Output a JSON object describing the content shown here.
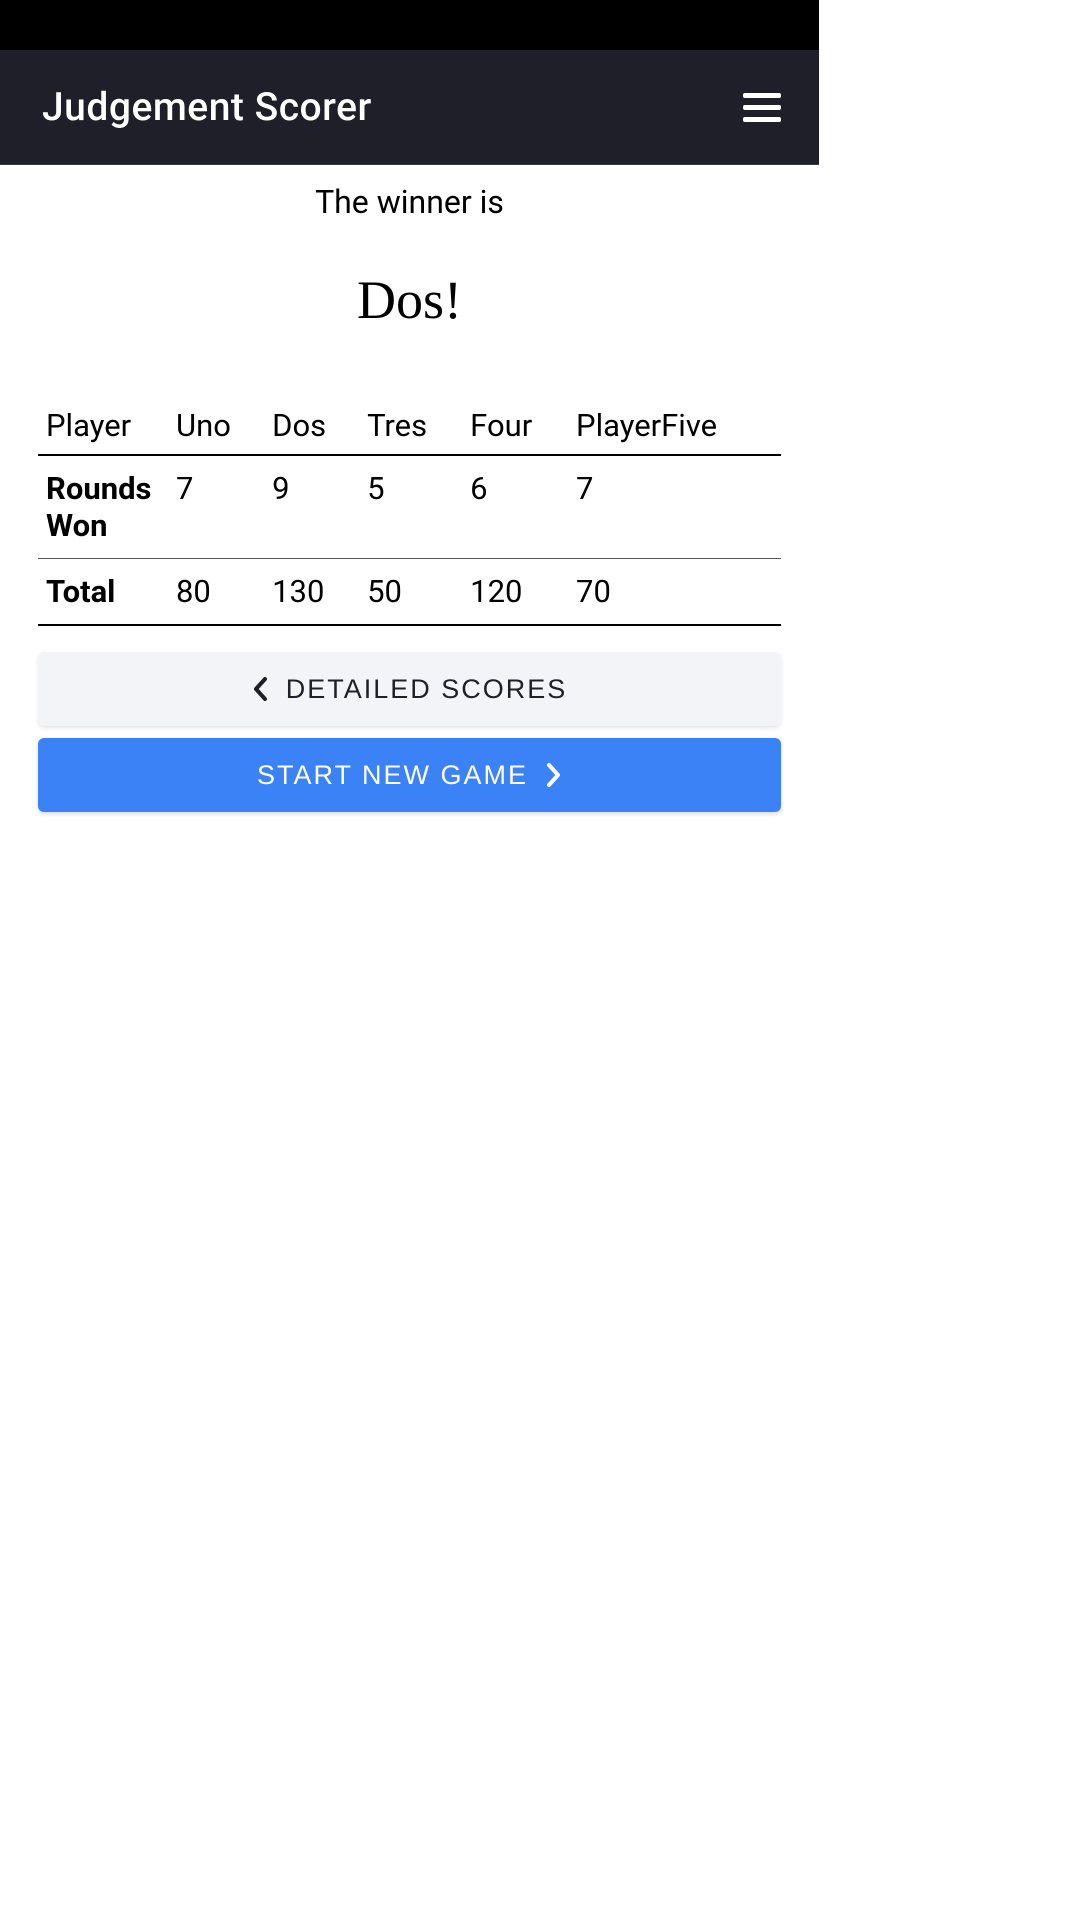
{
  "header": {
    "title": "Judgement Scorer"
  },
  "winner": {
    "label": "The winner is",
    "name": "Dos!"
  },
  "table": {
    "header_player": "Player",
    "players": [
      "Uno",
      "Dos",
      "Tres",
      "Four",
      "PlayerFive"
    ],
    "rows": [
      {
        "label": "Rounds Won",
        "values": [
          "7",
          "9",
          "5",
          "6",
          "7"
        ]
      },
      {
        "label": "Total",
        "values": [
          "80",
          "130",
          "50",
          "120",
          "70"
        ]
      }
    ]
  },
  "buttons": {
    "detailed_scores": "DETAILED SCORES",
    "start_new_game": "START NEW GAME"
  }
}
